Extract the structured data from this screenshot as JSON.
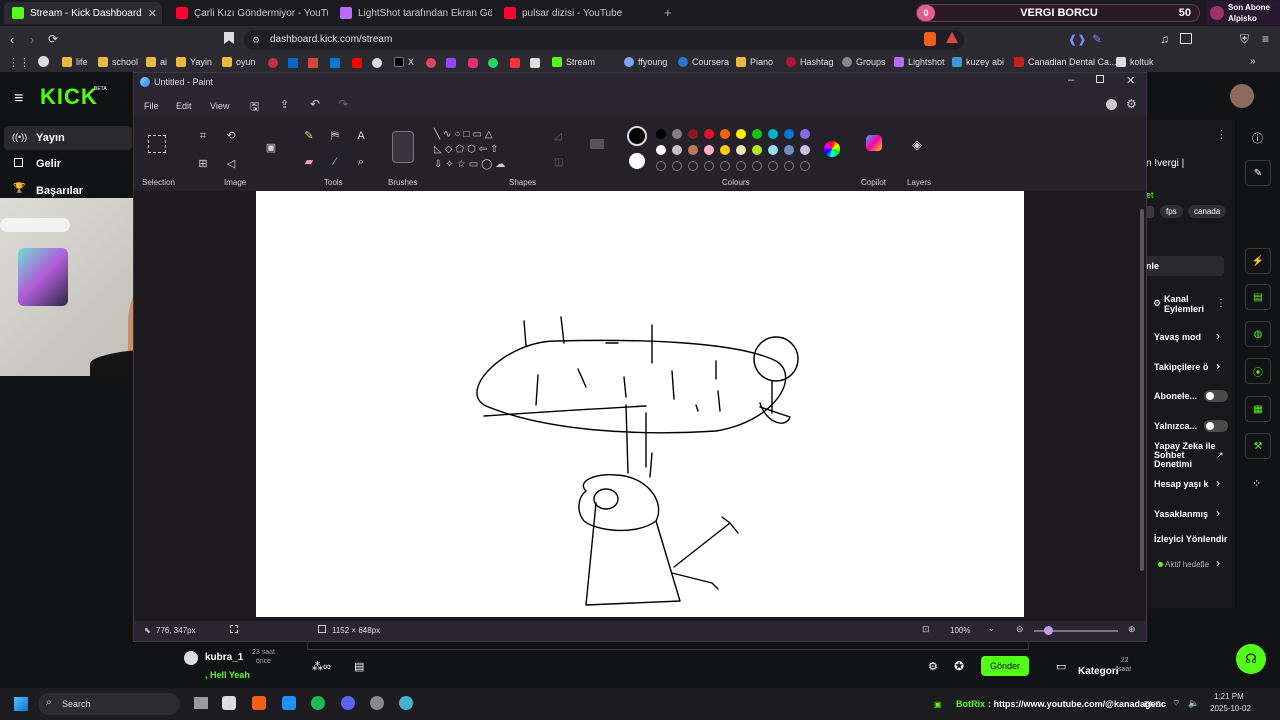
{
  "browser": {
    "tabs": [
      {
        "label": "Stream - Kick Dashboard",
        "active": true
      },
      {
        "label": "Çarli Kızı Göndermiyor - YouTube"
      },
      {
        "label": "LightShot tarafından Ekran Görüntü..."
      },
      {
        "label": "pulsar dizisi - YouTube"
      }
    ],
    "new_tab": "+",
    "goal_widget": {
      "left_value": "0",
      "title": "VERGI BORCU",
      "right_value": "50"
    },
    "sub_widget": {
      "line1": "Son Abone",
      "line2": "Alpisko"
    },
    "url": "dashboard.kick.com/stream",
    "bookmarks": [
      "life",
      "school",
      "ai",
      "Yayin",
      "oyun",
      "X",
      "Stream",
      "ffyoung",
      "Coursera",
      "Piano",
      "Hashtag",
      "Groups",
      "Lightshot",
      "kuzey abi",
      "Canadian Dental Ca...",
      "koltuk"
    ]
  },
  "kick": {
    "logo": "KICK",
    "logo_badge": "BETA",
    "nav": [
      "Yayın",
      "Gelir",
      "Başarılar"
    ],
    "chat": {
      "username": "kubra_1",
      "time": "23 saat\nönce",
      "message": ", Hell Yeah"
    },
    "send_button": "Gönder",
    "kategori": "Kategori",
    "kategori_time": "22\nsaat",
    "right_panel": {
      "title_partial": "n !vergi |",
      "tag_partial": "et",
      "tags": [
        "fps",
        "canada"
      ],
      "input_partial": "nle",
      "actions_title": "Kanal\nEylemleri",
      "actions": [
        "Yavaş mod",
        "Takipçilere ö",
        "Abonele...",
        "Yalnızca...",
        "Yapay Zeka ile Sohbet Denetimi",
        "Hesap yaşı k",
        "Yasaklanmış",
        "İzleyici Yönlendir",
        "Aktif hedefle"
      ]
    }
  },
  "paint": {
    "title": "Untitled - Paint",
    "menu": [
      "File",
      "Edit",
      "View"
    ],
    "groups": [
      "Selection",
      "Image",
      "Tools",
      "Brushes",
      "Shapes",
      "Colours",
      "Copilot",
      "Layers"
    ],
    "palette_row1": [
      "#000000",
      "#7f7f7f",
      "#8b1a1a",
      "#e81123",
      "#f7630c",
      "#fff100",
      "#16c60c",
      "#00b7c3",
      "#0078d7",
      "#886ce4"
    ],
    "palette_row2": [
      "#ffffff",
      "#c3c3c3",
      "#b97a57",
      "#ffaec9",
      "#ffc90e",
      "#efe4b0",
      "#b5e61d",
      "#99d9ea",
      "#7092be",
      "#c8bfe7"
    ],
    "status": {
      "cursor": "776, 347px",
      "size": "1152 × 648px",
      "zoom": "100%"
    }
  },
  "taskbar": {
    "search": "Search",
    "ticker_name": "BotRix",
    "ticker_text": ": https://www.youtube.com/@kanadagenc",
    "lang": "ENG",
    "time": "1:21 PM",
    "date": "2025-10-02"
  },
  "colors": {
    "kick_green": "#53fc18",
    "paint_bg": "#2a2530"
  }
}
